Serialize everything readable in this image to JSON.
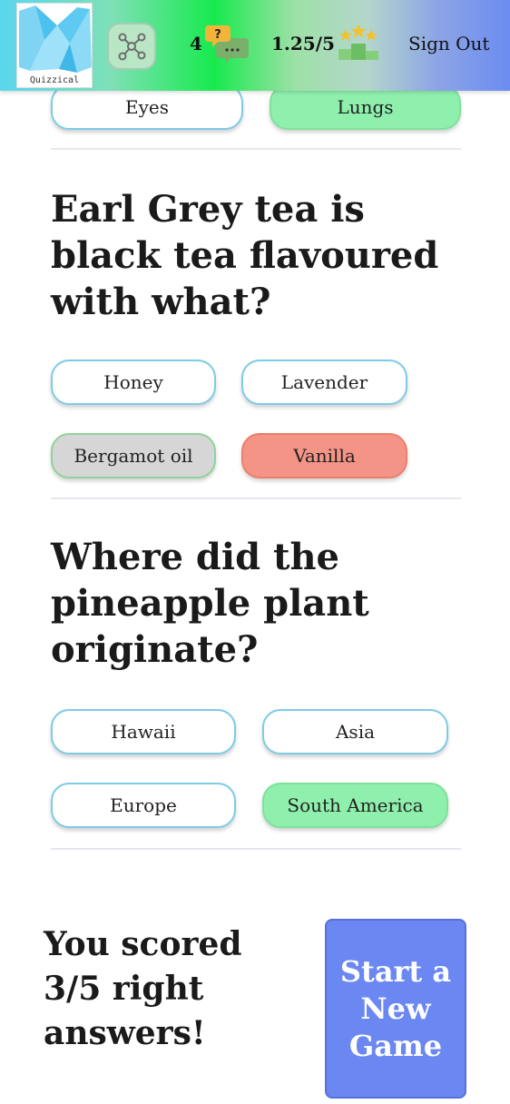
{
  "header": {
    "logo_text": "Quizzical",
    "count": "4",
    "score": "1.25/5",
    "sign_out_label": "Sign Out",
    "chat_icon": "question-chat-icon",
    "network_icon": "network-icon",
    "podium_icon": "podium-stars-icon"
  },
  "prev_question": {
    "answers": [
      "Eyes",
      "Lungs"
    ]
  },
  "questions": [
    {
      "text": "Earl Grey tea is black tea flavoured with what?",
      "answers": [
        "Honey",
        "Lavender",
        "Bergamot oil",
        "Vanilla"
      ]
    },
    {
      "text": "Where did the pineapple plant originate?",
      "answers": [
        "Hawaii",
        "Asia",
        "Europe",
        "South America"
      ]
    }
  ],
  "result": {
    "text": "You scored 3/5 right answers!",
    "new_game_label": "Start a New Game"
  },
  "colors": {
    "correct": "#8ff0ad",
    "wrong": "#f49487",
    "button_border": "#7ecbe6",
    "new_game": "#6b87f2"
  }
}
